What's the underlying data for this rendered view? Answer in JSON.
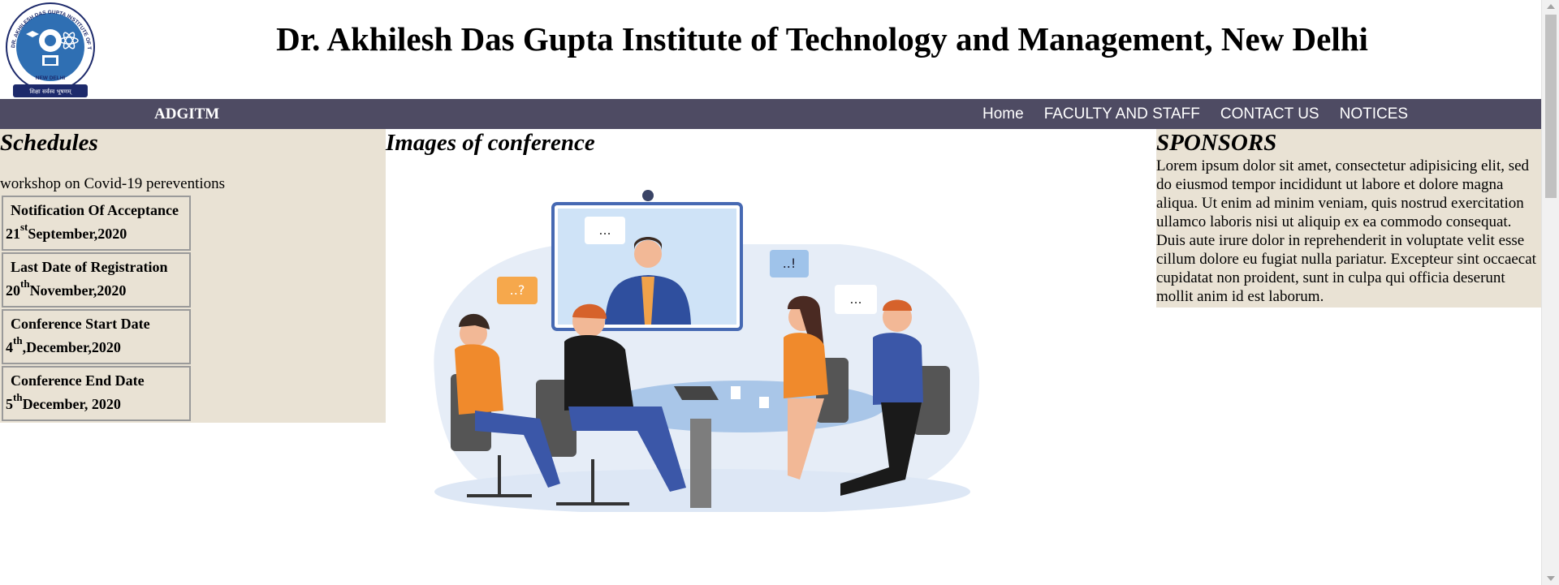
{
  "header": {
    "title": "Dr. Akhilesh Das Gupta Institute of Technology and Management, New Delhi",
    "logo_text": {
      "ring": "DR. AKHILESH DAS GUPTA INSTITUTE OF TECHNOLOGY & MANAGEMENT",
      "city": "NEW DELHI",
      "motto": "शिक्षा सर्वस्व भूषणम्"
    }
  },
  "navbar": {
    "brand": "ADGITM",
    "links": [
      "Home",
      "FACULTY AND STAFF",
      "CONTACT US",
      "NOTICES"
    ],
    "color": "#4e4b63"
  },
  "left": {
    "heading": "Schedules",
    "workshop": "workshop on Covid-19 pereventions",
    "schedules": [
      {
        "label": "Notification Of Acceptance",
        "day": "21",
        "suffix": "st",
        "rest": "September,2020"
      },
      {
        "label": "Last Date of Registration",
        "day": "20",
        "suffix": "th",
        "rest": "November,2020"
      },
      {
        "label": "Conference Start Date",
        "day": "4",
        "suffix": "th",
        "rest": ",December,2020"
      },
      {
        "label": "Conference End Date",
        "day": "5",
        "suffix": "th",
        "rest": "December, 2020"
      }
    ]
  },
  "center": {
    "heading": "Images of conference",
    "bubbles": [
      "...",
      "..!",
      "..?",
      "..."
    ]
  },
  "right": {
    "heading": "SPONSORS",
    "text": "Lorem ipsum dolor sit amet, consectetur adipisicing elit, sed do eiusmod tempor incididunt ut labore et dolore magna aliqua. Ut enim ad minim veniam, quis nostrud exercitation ullamco laboris nisi ut aliquip ex ea commodo consequat. Duis aute irure dolor in reprehenderit in voluptate velit esse cillum dolore eu fugiat nulla pariatur. Excepteur sint occaecat cupidatat non proident, sunt in culpa qui officia deserunt mollit anim id est laborum."
  },
  "colors": {
    "panel_bg": "#e9e2d4",
    "box_border": "#9a9a9a"
  }
}
